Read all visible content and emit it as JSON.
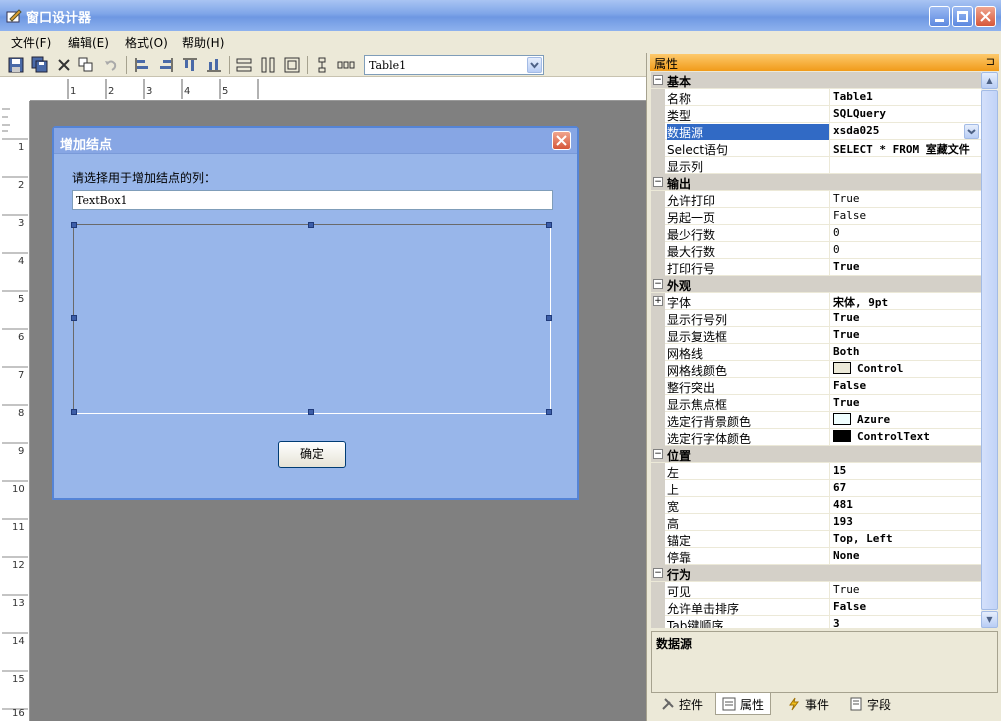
{
  "window": {
    "title": "窗口设计器"
  },
  "menu": [
    "文件(F)",
    "编辑(E)",
    "格式(O)",
    "帮助(H)"
  ],
  "toolbar": {
    "selected_object": "Table1"
  },
  "ruler": {
    "h": [
      "1",
      "2",
      "3",
      "4",
      "5"
    ],
    "v": [
      "1",
      "2",
      "3",
      "4",
      "5",
      "6",
      "7",
      "8",
      "9",
      "10",
      "11",
      "12",
      "13",
      "14",
      "15",
      "16"
    ]
  },
  "dialog": {
    "title": "增加结点",
    "prompt": "请选择用于增加结点的列：",
    "textbox_value": "TextBox1",
    "ok_label": "确定"
  },
  "properties_panel": {
    "title": "属性",
    "pin_icon": "⊐",
    "categories": [
      {
        "name": "基本",
        "rows": [
          {
            "name": "名称",
            "value": "Table1",
            "bold": true
          },
          {
            "name": "类型",
            "value": "SQLQuery",
            "bold": true
          },
          {
            "name": "数据源",
            "value": "xsda025",
            "bold": true,
            "selected": true
          },
          {
            "name": "Select语句",
            "value": "SELECT * FROM 室藏文件",
            "bold": true
          },
          {
            "name": "显示列",
            "value": ""
          }
        ]
      },
      {
        "name": "输出",
        "rows": [
          {
            "name": "允许打印",
            "value": "True"
          },
          {
            "name": "另起一页",
            "value": "False"
          },
          {
            "name": "最少行数",
            "value": "0"
          },
          {
            "name": "最大行数",
            "value": "0"
          },
          {
            "name": "打印行号",
            "value": "True",
            "bold": true
          }
        ]
      },
      {
        "name": "外观",
        "rows": [
          {
            "name": "字体",
            "value": "宋体, 9pt",
            "bold": true,
            "expandable": true
          },
          {
            "name": "显示行号列",
            "value": "True",
            "bold": true
          },
          {
            "name": "显示复选框",
            "value": "True",
            "bold": true
          },
          {
            "name": "网格线",
            "value": "Both",
            "bold": true
          },
          {
            "name": "网格线颜色",
            "value": "Control",
            "bold": true,
            "swatch": "#ece9d8"
          },
          {
            "name": "整行突出",
            "value": "False",
            "bold": true
          },
          {
            "name": "显示焦点框",
            "value": "True",
            "bold": true
          },
          {
            "name": "选定行背景颜色",
            "value": "Azure",
            "bold": true,
            "swatch": "#f0ffff"
          },
          {
            "name": "选定行字体颜色",
            "value": "ControlText",
            "bold": true,
            "swatch": "#000000"
          }
        ]
      },
      {
        "name": "位置",
        "rows": [
          {
            "name": "左",
            "value": "15",
            "bold": true
          },
          {
            "name": "上",
            "value": "67",
            "bold": true
          },
          {
            "name": "宽",
            "value": "481",
            "bold": true
          },
          {
            "name": "高",
            "value": "193",
            "bold": true
          },
          {
            "name": "锚定",
            "value": "Top, Left",
            "bold": true
          },
          {
            "name": "停靠",
            "value": "None",
            "bold": true
          }
        ]
      },
      {
        "name": "行为",
        "rows": [
          {
            "name": "可见",
            "value": "True"
          },
          {
            "name": "允许单击排序",
            "value": "False",
            "bold": true
          },
          {
            "name": "Tab键顺序",
            "value": "3",
            "bold": true
          }
        ]
      }
    ],
    "description_title": "数据源",
    "tabs": [
      {
        "label": "控件",
        "icon": "tools-icon"
      },
      {
        "label": "属性",
        "icon": "properties-icon",
        "active": true
      },
      {
        "label": "事件",
        "icon": "lightning-icon"
      },
      {
        "label": "字段",
        "icon": "field-icon"
      }
    ]
  }
}
